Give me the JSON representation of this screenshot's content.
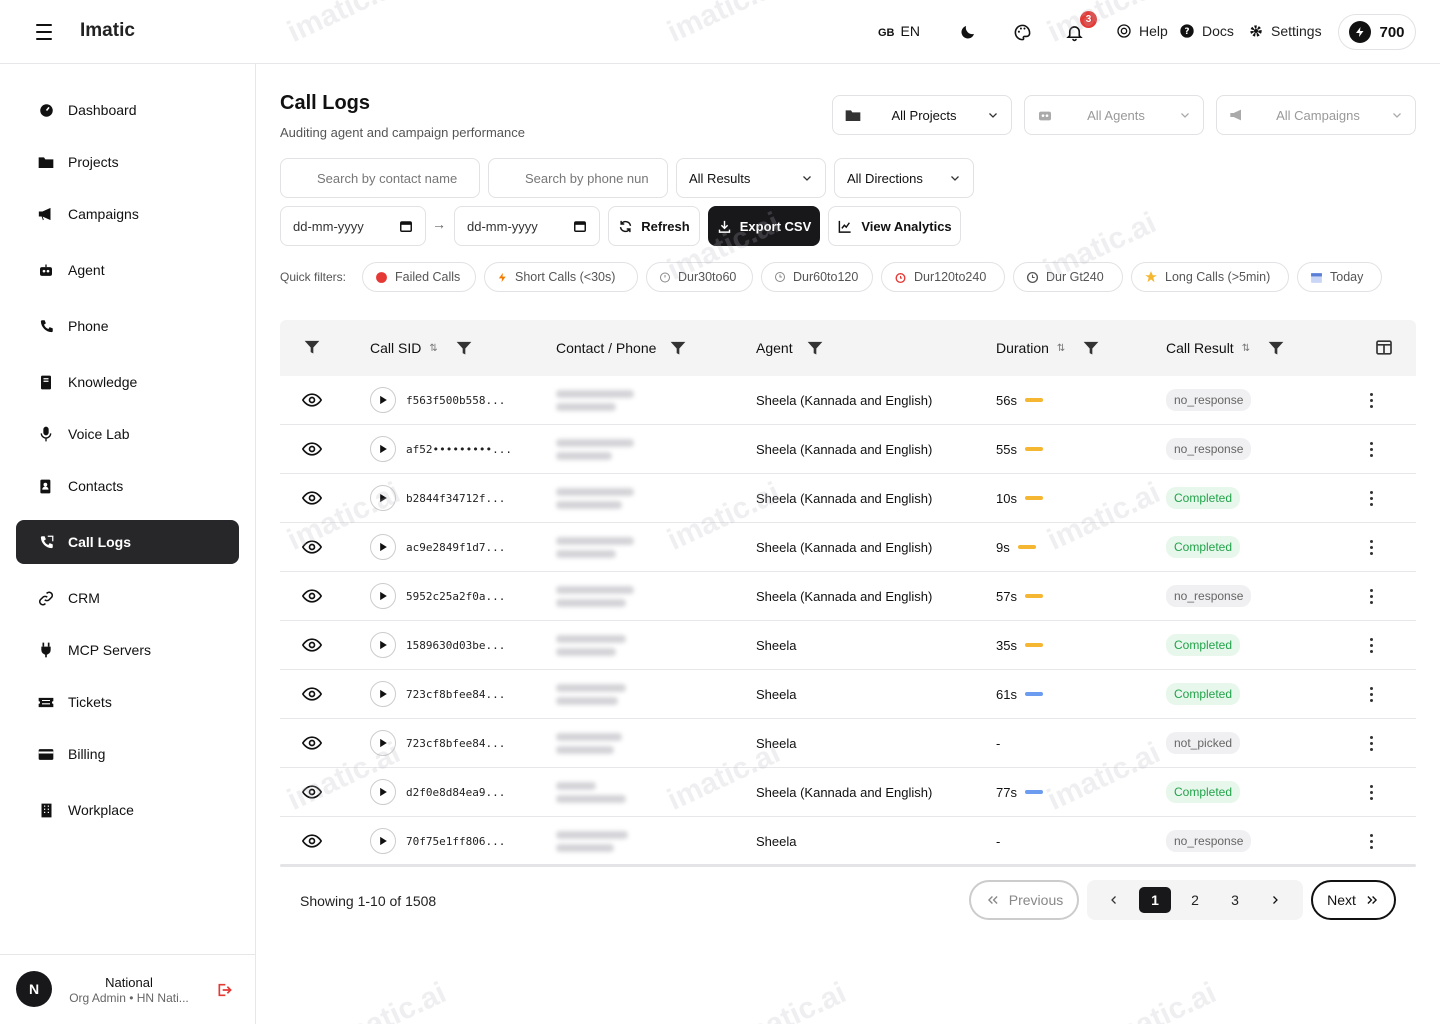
{
  "header": {
    "brand": "Imatic",
    "lang_flag": "GB",
    "lang_code": "EN",
    "notification_count": "3",
    "help_label": "Help",
    "docs_label": "Docs",
    "settings_label": "Settings",
    "credits": "700",
    "watermark": "imatic.ai"
  },
  "sidebar": {
    "items": [
      {
        "label": "Dashboard",
        "icon": "dashboard-icon"
      },
      {
        "label": "Projects",
        "icon": "folder-icon"
      },
      {
        "label": "Campaigns",
        "icon": "megaphone-icon"
      },
      {
        "label": "Agent",
        "icon": "robot-icon"
      },
      {
        "label": "Phone",
        "icon": "phone-icon"
      },
      {
        "label": "Knowledge",
        "icon": "book-icon"
      },
      {
        "label": "Voice Lab",
        "icon": "microphone-icon"
      },
      {
        "label": "Contacts",
        "icon": "contacts-icon"
      },
      {
        "label": "Call Logs",
        "icon": "phone-log-icon",
        "active": true
      },
      {
        "label": "CRM",
        "icon": "link-icon"
      },
      {
        "label": "MCP Servers",
        "icon": "plug-icon"
      },
      {
        "label": "Tickets",
        "icon": "ticket-icon"
      },
      {
        "label": "Billing",
        "icon": "card-icon"
      },
      {
        "label": "Workplace",
        "icon": "building-icon"
      }
    ],
    "user": {
      "initial": "N",
      "name": "National",
      "role": "Org Admin • HN Nati..."
    }
  },
  "main": {
    "title": "Call Logs",
    "subtitle": "Auditing agent and campaign performance",
    "filters": {
      "projects": "All Projects",
      "agents": "All Agents",
      "campaigns": "All Campaigns",
      "contact_placeholder": "Search by contact name",
      "phone_placeholder": "Search by phone nun",
      "results": "All Results",
      "directions": "All Directions",
      "date_from": "dd-mm-yyyy",
      "date_to": "dd-mm-yyyy",
      "date_sep": "→"
    },
    "actions": {
      "refresh": "Refresh",
      "export": "Export CSV",
      "analytics": "View Analytics"
    },
    "quick_filters_label": "Quick filters:",
    "quick_filters": [
      "Failed Calls",
      "Short Calls (<30s)",
      "Dur30to60",
      "Dur60to120",
      "Dur120to240",
      "Dur Gt240",
      "Long Calls (>5min)",
      "Today"
    ],
    "table": {
      "columns": [
        "Call SID",
        "Contact / Phone",
        "Agent",
        "Duration",
        "Call Result"
      ],
      "rows": [
        {
          "sid": "f563f500b558...",
          "agent": "Sheela (Kannada and English)",
          "duration": "56s",
          "bar": "#f5b731",
          "result": "no_response",
          "tone": "gray"
        },
        {
          "sid": "af52•••••••••...",
          "agent": "Sheela (Kannada and English)",
          "duration": "55s",
          "bar": "#f5b731",
          "result": "no_response",
          "tone": "gray"
        },
        {
          "sid": "b2844f34712f...",
          "agent": "Sheela (Kannada and English)",
          "duration": "10s",
          "bar": "#f5b731",
          "result": "Completed",
          "tone": "green"
        },
        {
          "sid": "ac9e2849f1d7...",
          "agent": "Sheela (Kannada and English)",
          "duration": "9s",
          "bar": "#f5b731",
          "result": "Completed",
          "tone": "green"
        },
        {
          "sid": "5952c25a2f0a...",
          "agent": "Sheela (Kannada and English)",
          "duration": "57s",
          "bar": "#f5b731",
          "result": "no_response",
          "tone": "gray"
        },
        {
          "sid": "1589630d03be...",
          "agent": "Sheela",
          "duration": "35s",
          "bar": "#f5b731",
          "result": "Completed",
          "tone": "green"
        },
        {
          "sid": "723cf8bfee84...",
          "agent": "Sheela",
          "duration": "61s",
          "bar": "#6b9cf0",
          "result": "Completed",
          "tone": "green"
        },
        {
          "sid": "723cf8bfee84...",
          "agent": "Sheela",
          "duration": "-",
          "bar": "",
          "result": "not_picked",
          "tone": "gray"
        },
        {
          "sid": "d2f0e8d84ea9...",
          "agent": "Sheela (Kannada and English)",
          "duration": "77s",
          "bar": "#6b9cf0",
          "result": "Completed",
          "tone": "green"
        },
        {
          "sid": "70f75e1ff806...",
          "agent": "Sheela",
          "duration": "-",
          "bar": "",
          "result": "no_response",
          "tone": "gray"
        }
      ]
    },
    "pagination": {
      "showing": "Showing 1-10 of 1508",
      "previous": "Previous",
      "next": "Next",
      "pages": [
        "1",
        "2",
        "3"
      ],
      "current": "1"
    }
  }
}
